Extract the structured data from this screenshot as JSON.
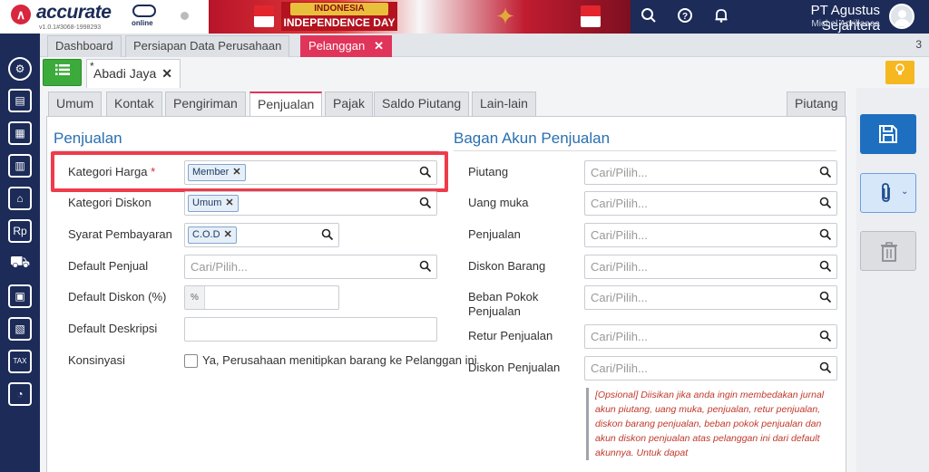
{
  "app": {
    "name": "accurate",
    "sub": "online",
    "version": "v1.0.1#3068-1998293"
  },
  "banner": {
    "line1": "INDONESIA",
    "line2": "INDEPENDENCE DAY"
  },
  "header": {
    "company": "PT Agustus Sejahtera",
    "user": "Michel Aprillaaaa"
  },
  "module_tabs": [
    {
      "label": "Dashboard"
    },
    {
      "label": "Persiapan Data Perusahaan"
    },
    {
      "label": "Pelanggan"
    }
  ],
  "module_tab_count": "3",
  "doc_tab": {
    "marker": "*",
    "label": "Abadi Jaya"
  },
  "form_tabs": [
    "Umum",
    "Kontak",
    "Pengiriman",
    "Penjualan",
    "Pajak",
    "Saldo Piutang",
    "Lain-lain"
  ],
  "form_tab_right": "Piutang",
  "left_section": {
    "title": "Penjualan",
    "kategori_harga_label": "Kategori Harga",
    "kategori_harga_required": "*",
    "kategori_harga_chip": "Member",
    "kategori_diskon_label": "Kategori Diskon",
    "kategori_diskon_chip": "Umum",
    "syarat_label": "Syarat Pembayaran",
    "syarat_chip": "C.O.D",
    "penjual_label": "Default Penjual",
    "penjual_placeholder": "Cari/Pilih...",
    "diskon_label": "Default Diskon (%)",
    "diskon_prefix": "%",
    "deskripsi_label": "Default Deskripsi",
    "konsinyasi_label": "Konsinyasi",
    "konsinyasi_option": "Ya, Perusahaan menitipkan barang ke Pelanggan ini"
  },
  "right_section": {
    "title": "Bagan Akun Penjualan",
    "placeholder": "Cari/Pilih...",
    "fields": [
      {
        "label": "Piutang"
      },
      {
        "label": "Uang muka"
      },
      {
        "label": "Penjualan"
      },
      {
        "label": "Diskon Barang"
      },
      {
        "label": "Beban Pokok Penjualan"
      },
      {
        "label": "Retur Penjualan"
      },
      {
        "label": "Diskon Penjualan"
      }
    ],
    "note": "[Opsional] Diisikan jika anda ingin membedakan jurnal akun piutang, uang muka, penjualan, retur penjualan, diskon barang penjualan, beban pokok penjualan dan akun diskon penjualan atas pelanggan ini dari default akunnya. Untuk dapat"
  },
  "colors": {
    "navy": "#1c2b58",
    "accent_pink": "#e0345a",
    "link_blue": "#2a6fb0",
    "highlight_red": "#ef3b4b",
    "save_blue": "#1f6fc0"
  }
}
